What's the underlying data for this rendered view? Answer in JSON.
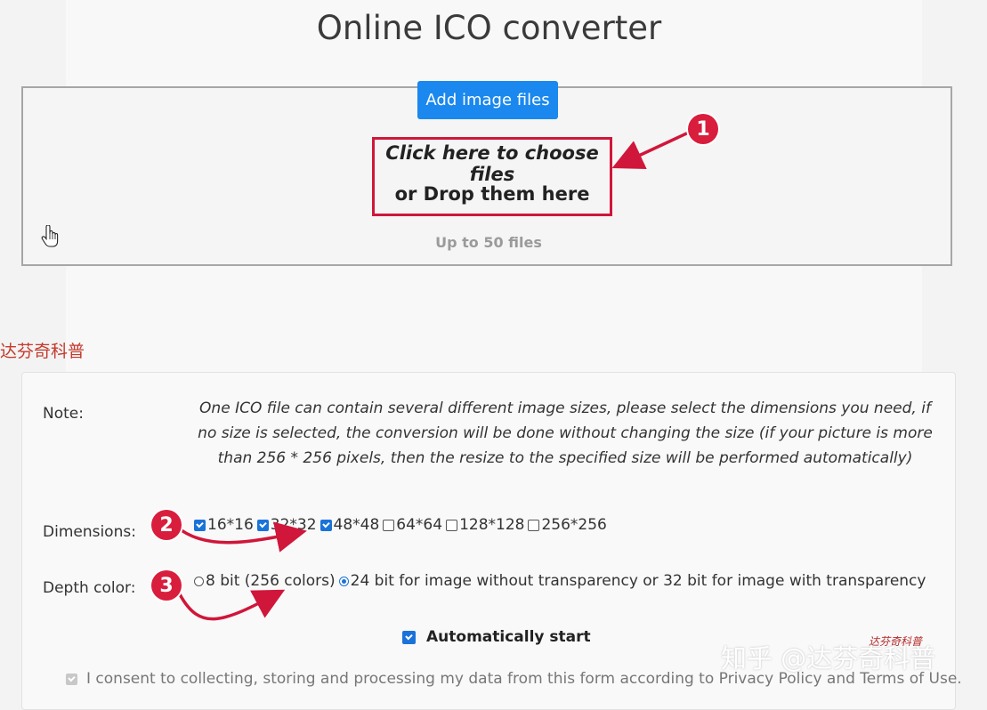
{
  "page": {
    "title": "Online ICO converter"
  },
  "upload": {
    "add_button": "Add image files",
    "choose_text": "Click here to choose files",
    "drop_text": "or Drop them here",
    "limit_text": "Up to 50 files"
  },
  "watermark_left": "达芬奇科普",
  "options": {
    "note_label": "Note:",
    "note_text": "One ICO file can contain several different image sizes, please select the dimensions you need, if no size is selected, the conversion will be done without changing the size (if your picture is more than 256 * 256 pixels, then the resize to the specified size will be performed automatically)",
    "dimensions_label": "Dimensions:",
    "dimensions": [
      {
        "label": "16*16",
        "checked": true
      },
      {
        "label": "32*32",
        "checked": true
      },
      {
        "label": "48*48",
        "checked": true
      },
      {
        "label": "64*64",
        "checked": false
      },
      {
        "label": "128*128",
        "checked": false
      },
      {
        "label": "256*256",
        "checked": false
      }
    ],
    "depth_label": "Depth color:",
    "depth_options": [
      {
        "label": "8 bit (256 colors)",
        "selected": false
      },
      {
        "label": "24 bit for image without transparency or 32 bit for image with transparency",
        "selected": true
      }
    ],
    "auto_start": "Automatically start",
    "consent": "I consent to collecting, storing and processing my data from this form according to Privacy Policy and Terms of Use."
  },
  "annotations": {
    "badge1": "1",
    "badge2": "2",
    "badge3": "3",
    "color": "#d91d3d"
  },
  "watermark_right": "知乎 @达芬奇科普",
  "stamp": "达芬奇科普",
  "colors": {
    "accent": "#1a88ee",
    "annotation": "#d0163a"
  }
}
